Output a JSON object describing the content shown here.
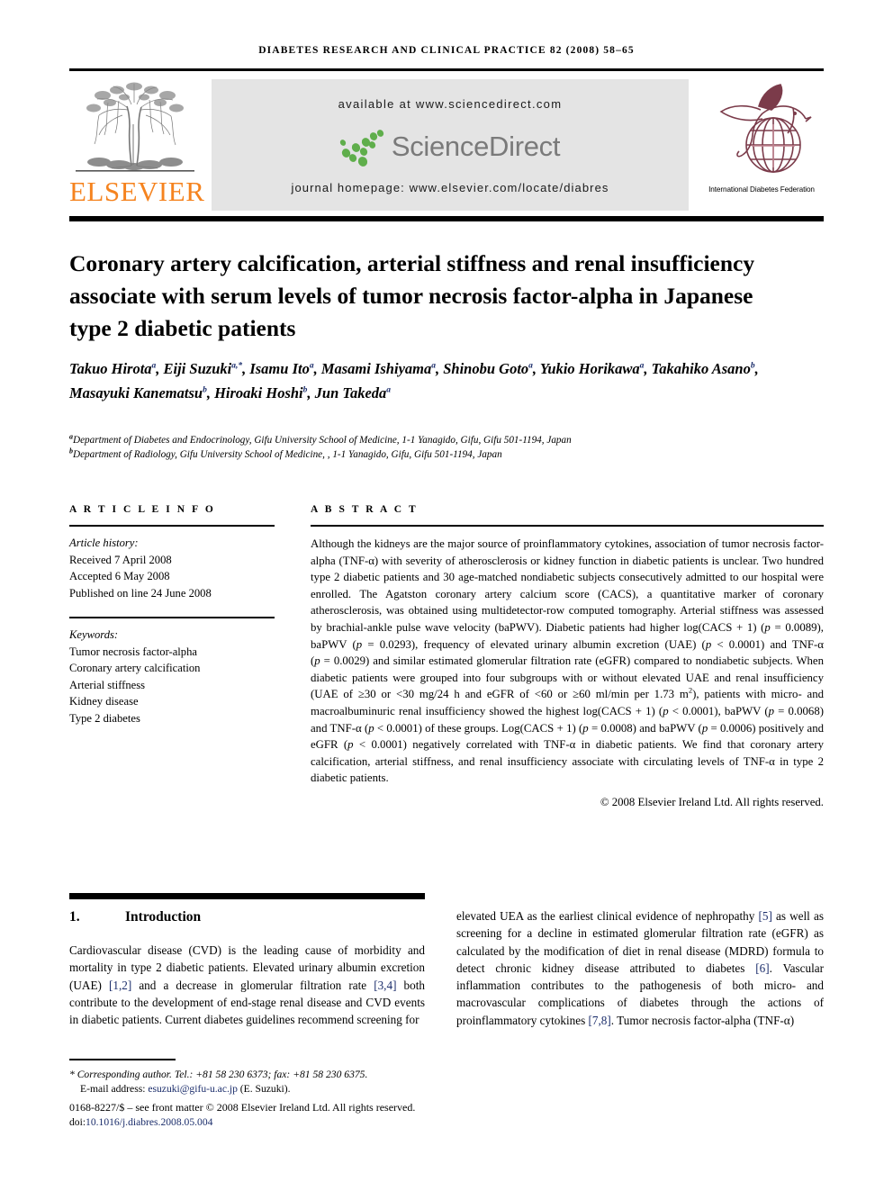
{
  "running_head": "DIABETES RESEARCH AND CLINICAL PRACTICE 82 (2008) 58–65",
  "masthead": {
    "publisher_wordmark": "ELSEVIER",
    "available_at": "available at www.sciencedirect.com",
    "sciencedirect_logo_text": "ScienceDirect",
    "journal_homepage": "journal homepage: www.elsevier.com/locate/diabres",
    "idf_caption": "International Diabetes Federation",
    "colors": {
      "elsevier_orange": "#F5831F",
      "sciencedirect_green": "#5FAE4B",
      "sciencedirect_grey": "#7a7a7a",
      "idf_maroon": "#7B3B4A",
      "banner_background": "#e4e4e4"
    }
  },
  "title": "Coronary artery calcification, arterial stiffness and renal insufficiency associate with serum levels of tumor necrosis factor-alpha in Japanese type 2 diabetic patients",
  "authors_html": "Takuo Hirota<sup>a</sup>, Eiji Suzuki<sup>a,*</sup>, Isamu Ito<sup>a</sup>, Masami Ishiyama<sup>a</sup>, Shinobu Goto<sup>a</sup>, Yukio Horikawa<sup>a</sup>, Takahiko Asano<sup>b</sup>, Masayuki Kanematsu<sup>b</sup>, Hiroaki Hoshi<sup>b</sup>, Jun Takeda<sup>a</sup>",
  "affiliations_html": "<sup>a</sup>Department of Diabetes and Endocrinology, Gifu University School of Medicine, 1-1 Yanagido, Gifu, Gifu 501-1194, Japan<br><sup>b</sup>Department of Radiology, Gifu University School of Medicine, , 1-1 Yanagido, Gifu, Gifu 501-1194, Japan",
  "article_info": {
    "heading": "A R T I C L E   I N F O",
    "history_label": "Article history:",
    "received": "Received 7 April 2008",
    "accepted": "Accepted 6 May 2008",
    "published": "Published on line 24 June 2008",
    "keywords_label": "Keywords:",
    "keywords": [
      "Tumor necrosis factor-alpha",
      "Coronary artery calcification",
      "Arterial stiffness",
      "Kidney disease",
      "Type 2 diabetes"
    ]
  },
  "abstract": {
    "heading": "A B S T R A C T",
    "body_html": "Although the kidneys are the major source of proinflammatory cytokines, association of tumor necrosis factor-alpha (TNF-&alpha;) with severity of atherosclerosis or kidney function in diabetic patients is unclear. Two hundred type 2 diabetic patients and 30 age-matched nondiabetic subjects consecutively admitted to our hospital were enrolled. The Agatston coronary artery calcium score (CACS), a quantitative marker of coronary atherosclerosis, was obtained using multidetector-row computed tomography. Arterial stiffness was assessed by brachial-ankle pulse wave velocity (baPWV). Diabetic patients had higher log(CACS&nbsp;+&nbsp;1) (<span class=\"it\">p</span>&nbsp;=&nbsp;0.0089), baPWV (<span class=\"it\">p</span>&nbsp;=&nbsp;0.0293), frequency of elevated urinary albumin excretion (UAE) (<span class=\"it\">p</span>&nbsp;&lt;&nbsp;0.0001) and TNF-&alpha; (<span class=\"it\">p</span>&nbsp;=&nbsp;0.0029) and similar estimated glomerular filtration rate (eGFR) compared to nondiabetic subjects. When diabetic patients were grouped into four subgroups with or without elevated UAE and renal insufficiency (UAE of &ge;30 or &lt;30 mg/24&nbsp;h and eGFR of &lt;60 or &ge;60 ml/min per 1.73 m<sup class=\"sm\">2</sup>), patients with micro- and macroalbuminuric renal insufficiency showed the highest log(CACS&nbsp;+&nbsp;1) (<span class=\"it\">p</span>&nbsp;&lt;&nbsp;0.0001), baPWV (<span class=\"it\">p</span>&nbsp;=&nbsp;0.0068) and TNF-&alpha; (<span class=\"it\">p</span>&nbsp;&lt;&nbsp;0.0001) of these groups. Log(CACS&nbsp;+&nbsp;1) (<span class=\"it\">p</span>&nbsp;=&nbsp;0.0008) and baPWV (<span class=\"it\">p</span>&nbsp;=&nbsp;0.0006) positively and eGFR (<span class=\"it\">p</span>&nbsp;&lt;&nbsp;0.0001) negatively correlated with TNF-&alpha; in diabetic patients. We find that coronary artery calcification, arterial stiffness, and renal insufficiency associate with circulating levels of TNF-&alpha; in type 2 diabetic patients.",
    "copyright": "© 2008 Elsevier Ireland Ltd. All rights reserved."
  },
  "introduction": {
    "number": "1.",
    "heading": "Introduction",
    "left_column_html": "Cardiovascular disease (CVD) is the leading cause of morbidity and mortality in type 2 diabetic patients. Elevated urinary albumin excretion (UAE) <span class=\"ref\">[1,2]</span> and a decrease in glomerular filtration rate <span class=\"ref\">[3,4]</span> both contribute to the development of end-stage renal disease and CVD events in diabetic patients. Current diabetes guidelines recommend screening for",
    "right_column_html": "elevated UEA as the earliest clinical evidence of nephropathy <span class=\"ref\">[5]</span> as well as screening for a decline in estimated glomerular filtration rate (eGFR) as calculated by the modification of diet in renal disease (MDRD) formula to detect chronic kidney disease attributed to diabetes <span class=\"ref\">[6]</span>. Vascular inflammation contributes to the pathogenesis of both micro- and macrovascular complications of diabetes through the actions of proinflammatory cytokines <span class=\"ref\">[7,8]</span>. Tumor necrosis factor-alpha (TNF-&alpha;)"
  },
  "footnotes": {
    "corresponding_html": "* <span class=\"it\">Corresponding author. Tel.: +81 58 230 6373; fax: +81 58 230 6375.</span>",
    "email_html": "E-mail address: <a class=\"link\" href=\"#\">esuzuki@gifu-u.ac.jp</a> (E. Suzuki).",
    "front_matter_html": "0168-8227/$ – see front matter © 2008 Elsevier Ireland Ltd. All rights reserved.",
    "doi_html": "doi:<a class=\"link\" href=\"#\">10.1016/j.diabres.2008.05.004</a>"
  }
}
